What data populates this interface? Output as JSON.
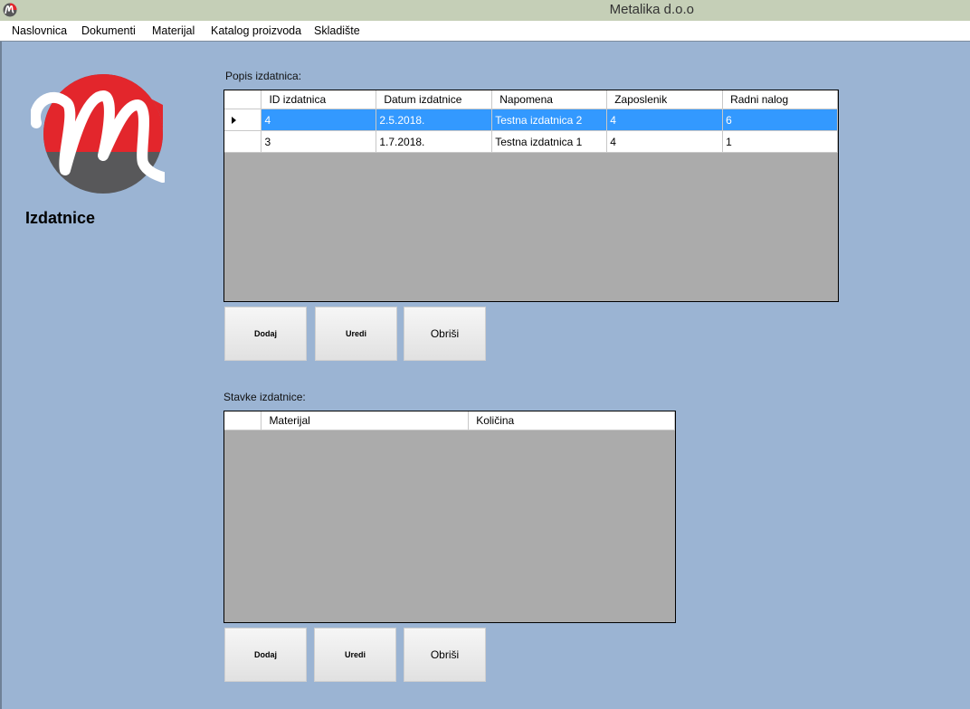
{
  "window": {
    "title": "Metalika d.o.o"
  },
  "menu": [
    "Naslovnica",
    "Dokumenti",
    "Materijal",
    "Katalog proizvoda",
    "Skladište"
  ],
  "page": {
    "title": "Izdatnice"
  },
  "izdatnice": {
    "label": "Popis izdatnica:",
    "columns": [
      "ID izdatnica",
      "Datum izdatnice",
      "Napomena",
      "Zaposlenik",
      "Radni nalog"
    ],
    "rows": [
      [
        "4",
        "2.5.2018.",
        "Testna izdatnica 2",
        "4",
        "6"
      ],
      [
        "3",
        "1.7.2018.",
        "Testna izdatnica 1",
        "4",
        "1"
      ]
    ],
    "selected_row": 0,
    "buttons": {
      "add": "Dodaj",
      "edit": "Uredi",
      "delete": "Obriši"
    }
  },
  "stavke": {
    "label": "Stavke izdatnice:",
    "columns": [
      "Materijal",
      "Količina"
    ],
    "rows": [],
    "buttons": {
      "add": "Dodaj",
      "edit": "Uredi",
      "delete": "Obriši"
    }
  },
  "colors": {
    "background": "#9bb4d3",
    "selection": "#3399ff",
    "logo_red": "#e3262c",
    "logo_gray": "#58585a"
  },
  "icons": {
    "app": "metalika-logo-icon",
    "row_pointer": "row-pointer-icon"
  }
}
